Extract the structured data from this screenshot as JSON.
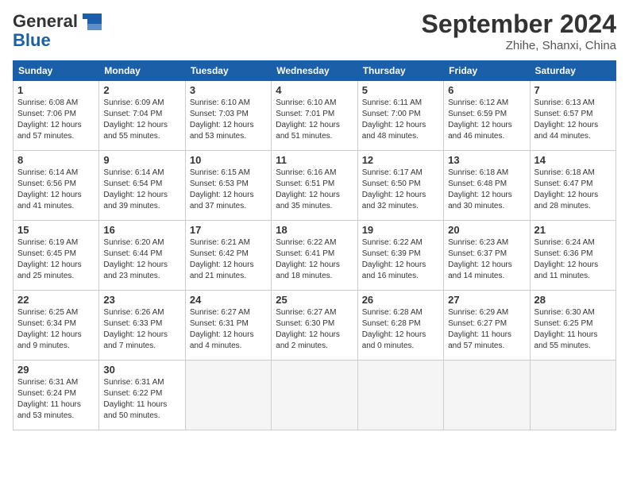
{
  "header": {
    "logo_line1": "General",
    "logo_line2": "Blue",
    "month_title": "September 2024",
    "subtitle": "Zhihe, Shanxi, China"
  },
  "weekdays": [
    "Sunday",
    "Monday",
    "Tuesday",
    "Wednesday",
    "Thursday",
    "Friday",
    "Saturday"
  ],
  "weeks": [
    [
      {
        "day": "1",
        "sunrise": "6:08 AM",
        "sunset": "7:06 PM",
        "daylight": "12 hours and 57 minutes."
      },
      {
        "day": "2",
        "sunrise": "6:09 AM",
        "sunset": "7:04 PM",
        "daylight": "12 hours and 55 minutes."
      },
      {
        "day": "3",
        "sunrise": "6:10 AM",
        "sunset": "7:03 PM",
        "daylight": "12 hours and 53 minutes."
      },
      {
        "day": "4",
        "sunrise": "6:10 AM",
        "sunset": "7:01 PM",
        "daylight": "12 hours and 51 minutes."
      },
      {
        "day": "5",
        "sunrise": "6:11 AM",
        "sunset": "7:00 PM",
        "daylight": "12 hours and 48 minutes."
      },
      {
        "day": "6",
        "sunrise": "6:12 AM",
        "sunset": "6:59 PM",
        "daylight": "12 hours and 46 minutes."
      },
      {
        "day": "7",
        "sunrise": "6:13 AM",
        "sunset": "6:57 PM",
        "daylight": "12 hours and 44 minutes."
      }
    ],
    [
      {
        "day": "8",
        "sunrise": "6:14 AM",
        "sunset": "6:56 PM",
        "daylight": "12 hours and 41 minutes."
      },
      {
        "day": "9",
        "sunrise": "6:14 AM",
        "sunset": "6:54 PM",
        "daylight": "12 hours and 39 minutes."
      },
      {
        "day": "10",
        "sunrise": "6:15 AM",
        "sunset": "6:53 PM",
        "daylight": "12 hours and 37 minutes."
      },
      {
        "day": "11",
        "sunrise": "6:16 AM",
        "sunset": "6:51 PM",
        "daylight": "12 hours and 35 minutes."
      },
      {
        "day": "12",
        "sunrise": "6:17 AM",
        "sunset": "6:50 PM",
        "daylight": "12 hours and 32 minutes."
      },
      {
        "day": "13",
        "sunrise": "6:18 AM",
        "sunset": "6:48 PM",
        "daylight": "12 hours and 30 minutes."
      },
      {
        "day": "14",
        "sunrise": "6:18 AM",
        "sunset": "6:47 PM",
        "daylight": "12 hours and 28 minutes."
      }
    ],
    [
      {
        "day": "15",
        "sunrise": "6:19 AM",
        "sunset": "6:45 PM",
        "daylight": "12 hours and 25 minutes."
      },
      {
        "day": "16",
        "sunrise": "6:20 AM",
        "sunset": "6:44 PM",
        "daylight": "12 hours and 23 minutes."
      },
      {
        "day": "17",
        "sunrise": "6:21 AM",
        "sunset": "6:42 PM",
        "daylight": "12 hours and 21 minutes."
      },
      {
        "day": "18",
        "sunrise": "6:22 AM",
        "sunset": "6:41 PM",
        "daylight": "12 hours and 18 minutes."
      },
      {
        "day": "19",
        "sunrise": "6:22 AM",
        "sunset": "6:39 PM",
        "daylight": "12 hours and 16 minutes."
      },
      {
        "day": "20",
        "sunrise": "6:23 AM",
        "sunset": "6:37 PM",
        "daylight": "12 hours and 14 minutes."
      },
      {
        "day": "21",
        "sunrise": "6:24 AM",
        "sunset": "6:36 PM",
        "daylight": "12 hours and 11 minutes."
      }
    ],
    [
      {
        "day": "22",
        "sunrise": "6:25 AM",
        "sunset": "6:34 PM",
        "daylight": "12 hours and 9 minutes."
      },
      {
        "day": "23",
        "sunrise": "6:26 AM",
        "sunset": "6:33 PM",
        "daylight": "12 hours and 7 minutes."
      },
      {
        "day": "24",
        "sunrise": "6:27 AM",
        "sunset": "6:31 PM",
        "daylight": "12 hours and 4 minutes."
      },
      {
        "day": "25",
        "sunrise": "6:27 AM",
        "sunset": "6:30 PM",
        "daylight": "12 hours and 2 minutes."
      },
      {
        "day": "26",
        "sunrise": "6:28 AM",
        "sunset": "6:28 PM",
        "daylight": "12 hours and 0 minutes."
      },
      {
        "day": "27",
        "sunrise": "6:29 AM",
        "sunset": "6:27 PM",
        "daylight": "11 hours and 57 minutes."
      },
      {
        "day": "28",
        "sunrise": "6:30 AM",
        "sunset": "6:25 PM",
        "daylight": "11 hours and 55 minutes."
      }
    ],
    [
      {
        "day": "29",
        "sunrise": "6:31 AM",
        "sunset": "6:24 PM",
        "daylight": "11 hours and 53 minutes."
      },
      {
        "day": "30",
        "sunrise": "6:31 AM",
        "sunset": "6:22 PM",
        "daylight": "11 hours and 50 minutes."
      },
      null,
      null,
      null,
      null,
      null
    ]
  ]
}
